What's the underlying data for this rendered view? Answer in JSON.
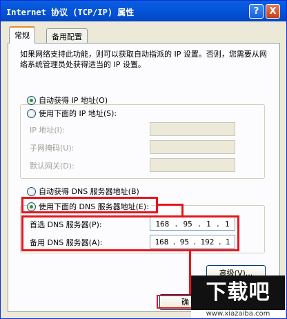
{
  "window": {
    "title": "Internet 协议 (TCP/IP) 属性",
    "help_button": "?",
    "close_button": "X"
  },
  "tabs": [
    {
      "label": "常规",
      "active": true
    },
    {
      "label": "备用配置",
      "active": false
    }
  ],
  "intro_text": "如果网络支持此功能，则可以获取自动指派的 IP 设置。否则，您需要从网络系统管理员处获得适当的 IP 设置。",
  "ip_section": {
    "auto_label": "自动获得 IP 地址(O)",
    "auto_selected": true,
    "manual_label": "使用下面的 IP 地址(S):",
    "manual_selected": false,
    "fields": [
      {
        "label": "IP 地址(I):",
        "value": ""
      },
      {
        "label": "子网掩码(U):",
        "value": ""
      },
      {
        "label": "默认网关(D):",
        "value": ""
      }
    ]
  },
  "dns_section": {
    "auto_label": "自动获得 DNS 服务器地址(B)",
    "auto_selected": false,
    "manual_label": "使用下面的 DNS 服务器地址(E):",
    "manual_selected": true,
    "preferred": {
      "label": "首选 DNS 服务器(P):",
      "octets": [
        "168",
        "95",
        "1",
        "1"
      ]
    },
    "alternate": {
      "label": "备用 DNS 服务器(A):",
      "octets": [
        "168",
        "95",
        "192",
        "1"
      ]
    }
  },
  "buttons": {
    "advanced": "高级(V)...",
    "ok": "确"
  },
  "watermark": {
    "main": "下载吧",
    "sub": "www.xiazaiba.com"
  },
  "colors": {
    "titlebar": "#0554d8",
    "highlight_red": "#e8141b",
    "radio_selected": "#21a121"
  }
}
